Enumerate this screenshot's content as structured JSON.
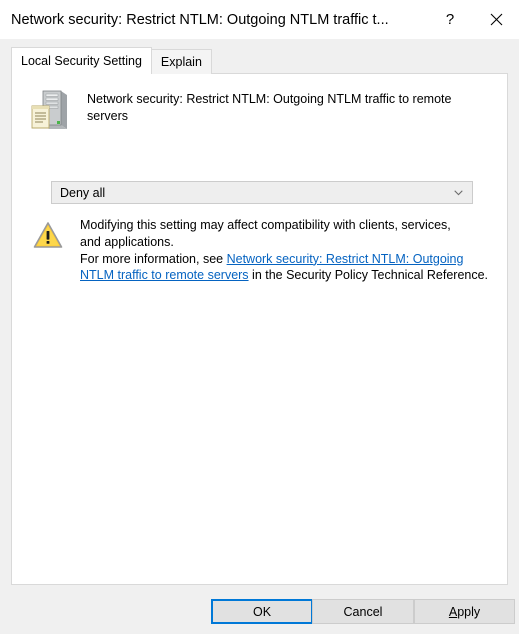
{
  "window": {
    "title": "Network security: Restrict NTLM: Outgoing NTLM traffic t...",
    "help_icon": "question-mark-icon",
    "close_icon": "close-x-icon",
    "accent_color": "#0078d7",
    "titlebar_background": "#ffffff",
    "dialog_background": "#f0f0f0"
  },
  "tabs": [
    {
      "label": "Local Security Setting",
      "active": true
    },
    {
      "label": "Explain",
      "active": false
    }
  ],
  "policy": {
    "icon": "policy-computer-document-icon",
    "title": "Network security: Restrict NTLM: Outgoing NTLM traffic to remote servers"
  },
  "setting": {
    "control": "combobox",
    "value": "Deny all",
    "arrow_icon": "chevron-down-icon",
    "background": "#eeeeee"
  },
  "warning": {
    "icon": "warning-triangle-icon",
    "icon_color": "#ffcc33",
    "line1": "Modifying this setting may affect compatibility with clients, services,",
    "line2": "and applications.",
    "prefix": "For more information, see ",
    "link_text": "Network security: Restrict NTLM: Outgoing NTLM traffic to remote servers",
    "link_color": "#0563c1",
    "suffix": " in the Security Policy Technical Reference."
  },
  "footer": {
    "ok_label": "OK",
    "cancel_label": "Cancel",
    "apply_mnemonic": "A",
    "apply_rest": "pply"
  }
}
